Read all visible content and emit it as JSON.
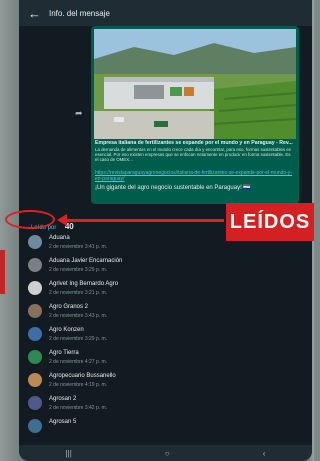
{
  "header": {
    "title": "Info. del mensaje",
    "back_icon": "arrow-left-icon"
  },
  "preview": {
    "title": "Empresa italiana de fertilizantes se expande por el mundo y en Paraguay - Rev...",
    "description": "La demanda de alimentos en el mundo crece cada día y encontrar, para eso, formas sustentables es esencial. Por eso existen empresas que se enfocan netamente en producir en forma sustentable. Es el caso de OMEX...",
    "link": "https://revistaparaguayagronegocios/italiana-de-fertilizantes-se-expande-por-el-mundo-y-en-paraguay/",
    "message": "¡Un gigante del agro negocio sustentable en Paraguay! 🇵🇾",
    "share_icon": "forward-icon"
  },
  "read": {
    "label": "Leído por",
    "count": "40"
  },
  "annotation": {
    "badge": "LEÍDOS",
    "color": "#d42020"
  },
  "contacts": [
    {
      "name": "Aduana",
      "date": "2 de noviembre 3:41 p. m."
    },
    {
      "name": "Aduana Javier Encarnación",
      "date": "2 de noviembre 3:29 p. m."
    },
    {
      "name": "Agrivet Ing Bernardo Agro",
      "date": "2 de noviembre 3:21 p. m."
    },
    {
      "name": "Agro Granos 2",
      "date": "2 de noviembre 3:43 p. m."
    },
    {
      "name": "Agro Konzen",
      "date": "2 de noviembre 3:29 p. m."
    },
    {
      "name": "Agro Tierra",
      "date": "2 de noviembre 4:27 p. m."
    },
    {
      "name": "Agropecuario Bussanello",
      "date": "2 de noviembre 4:19 p. m."
    },
    {
      "name": "Agrosan 2",
      "date": "2 de noviembre 3:42 p. m."
    },
    {
      "name": "Agrosan 5",
      "date": ""
    }
  ],
  "navbar": {
    "recent_icon": "recent-apps-icon",
    "home_icon": "home-icon",
    "back_icon": "nav-back-icon"
  }
}
